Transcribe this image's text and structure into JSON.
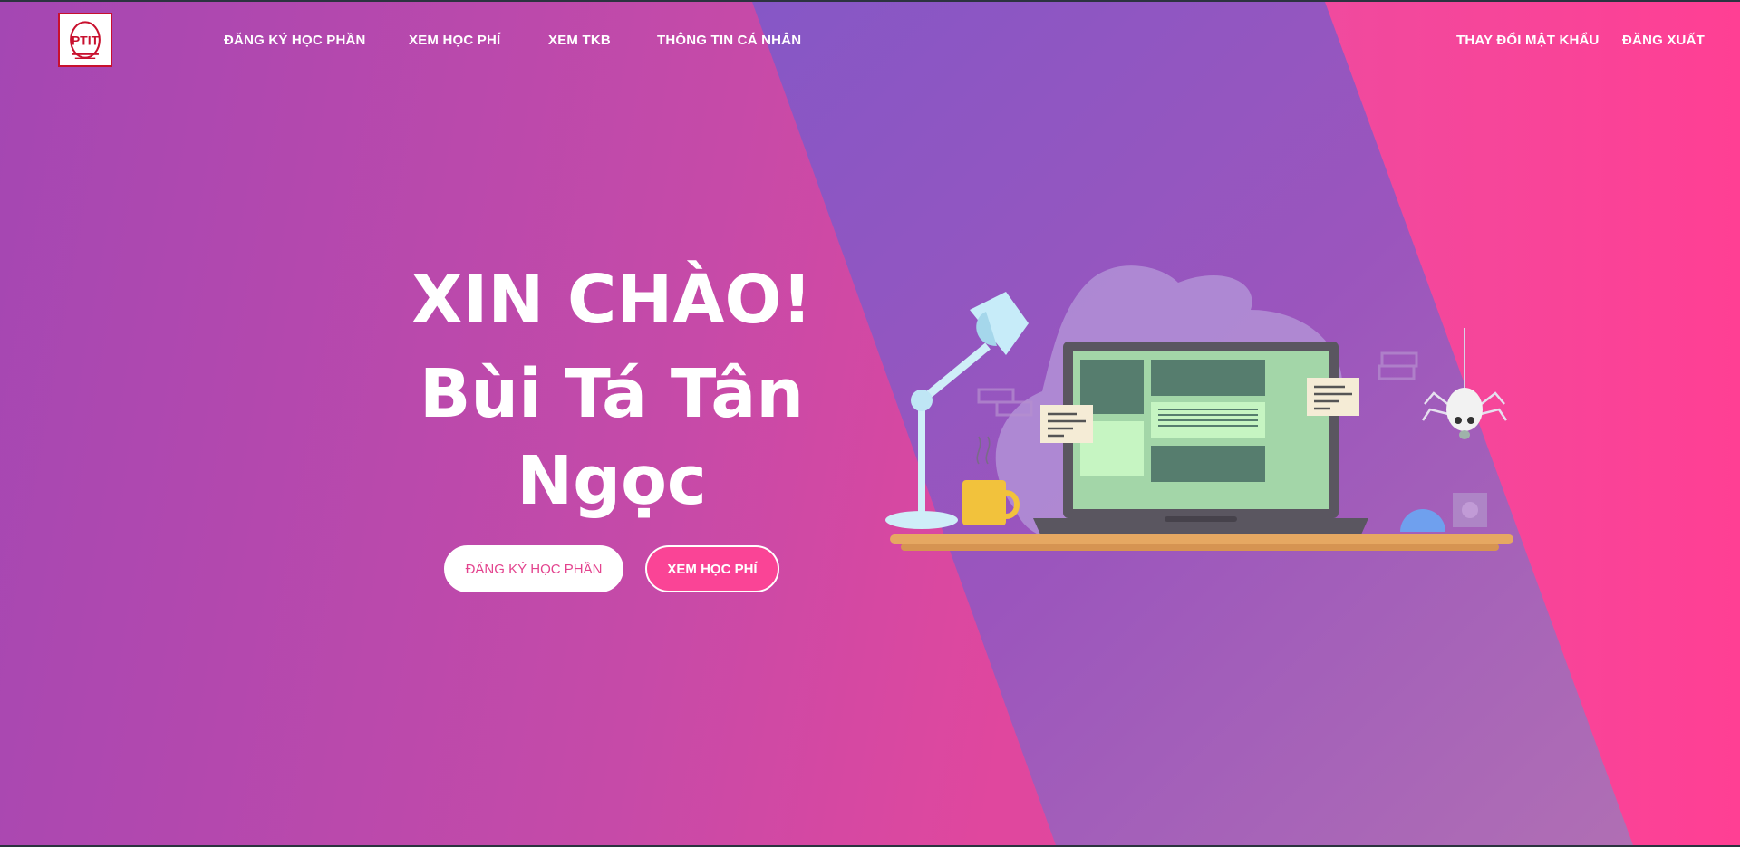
{
  "nav": {
    "logo_text": "PTIT",
    "links_left": [
      {
        "label": "ĐĂNG KÝ HỌC PHẦN"
      },
      {
        "label": "XEM HỌC PHÍ"
      },
      {
        "label": "XEM TKB"
      },
      {
        "label": "THÔNG TIN CÁ NHÂN"
      }
    ],
    "links_right": [
      {
        "label": "THAY ĐỔI MẬT KHẨU"
      },
      {
        "label": "ĐĂNG XUẤT"
      }
    ]
  },
  "hero": {
    "greeting": "XIN CHÀO!",
    "name_line1": "Bùi Tá Tân",
    "name_line2": "Ngọc",
    "primary_button": "ĐĂNG KÝ HỌC PHẦN",
    "secondary_button": "XEM HỌC PHÍ"
  },
  "colors": {
    "bg_left": "#a447b3",
    "bg_right": "#f8449a",
    "stripe": "#8e55c2",
    "accent_pink": "#fa4496",
    "logo_red": "#c8102e"
  },
  "icons": {
    "logo": "ptit-logo-icon",
    "illustration": "desk-laptop-illustration"
  }
}
